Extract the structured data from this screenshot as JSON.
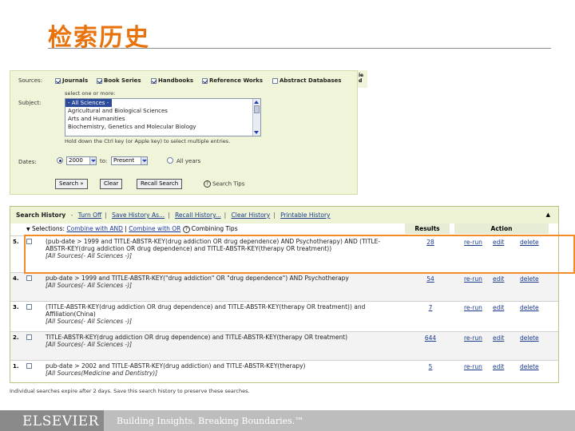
{
  "slide": {
    "title": "检索历史"
  },
  "search_form": {
    "panel_cut_text": "ie d",
    "sources_label": "Sources:",
    "sources": [
      {
        "label": "Journals",
        "checked": true
      },
      {
        "label": "Book Series",
        "checked": true
      },
      {
        "label": "Handbooks",
        "checked": true
      },
      {
        "label": "Reference Works",
        "checked": true
      },
      {
        "label": "Abstract Databases",
        "checked": false
      }
    ],
    "subject_label": "Subject:",
    "subject_hint": "select one or more:",
    "subject_options": [
      "- All Sciences -",
      "Agricultural and Biological Sciences",
      "Arts and Humanities",
      "Biochemistry, Genetics and Molecular Biology"
    ],
    "subject_help": "Hold down the Ctrl key (or Apple key) to select multiple entries.",
    "dates_label": "Dates:",
    "date_from": "2000",
    "date_to_label": "to:",
    "date_to": "Present",
    "all_years_label": "All years",
    "buttons": {
      "search": "Search »",
      "clear": "Clear",
      "recall": "Recall Search"
    },
    "search_tips": "Search Tips"
  },
  "history": {
    "title": "Search History",
    "links": [
      "Turn Off",
      "Save History As...",
      "Recall History...",
      "Clear History",
      "Printable History"
    ],
    "select_label": "Selections:",
    "combine_and": "Combine with AND",
    "combine_or": "Combine with OR",
    "combining_tips": "Combining Tips",
    "columns": {
      "results": "Results",
      "action": "Action"
    },
    "action_labels": {
      "rerun": "re-run",
      "edit": "edit",
      "delete": "delete"
    },
    "rows": [
      {
        "num": "5.",
        "query": "(pub-date > 1999 and TITLE-ABSTR-KEY(drug addiction OR drug dependence) AND Psychotherapy) AND (TITLE-ABSTR-KEY(drug addiction OR drug dependence) and TITLE-ABSTR-KEY(therapy OR treatment))",
        "sources": "[All Sources(- All Sciences -)]",
        "results": "28"
      },
      {
        "num": "4.",
        "query": "pub-date > 1999 and TITLE-ABSTR-KEY(\"drug addiction\" OR \"drug dependence\") AND Psychotherapy",
        "sources": "[All Sources(- All Sciences -)]",
        "results": "54"
      },
      {
        "num": "3.",
        "query": "(TITLE-ABSTR-KEY(drug addiction OR drug dependence) and TITLE-ABSTR-KEY(therapy OR treatment)) and Affiliation(China)",
        "sources": "[All Sources(- All Sciences -)]",
        "results": "7"
      },
      {
        "num": "2.",
        "query": "TITLE-ABSTR-KEY(drug addiction OR drug dependence) and TITLE-ABSTR-KEY(therapy OR treatment)",
        "sources": "[All Sources(- All Sciences -)]",
        "results": "644"
      },
      {
        "num": "1.",
        "query": "pub-date > 2002 and TITLE-ABSTR-KEY(drug addiction) and TITLE-ABSTR-KEY(therapy)",
        "sources": "[All Sources(Medicine and Dentistry)]",
        "results": "5"
      }
    ],
    "footnote": "Individual searches expire after 2 days. Save this search history to preserve these searches."
  },
  "footer": {
    "logo": "ELSEVIER",
    "tagline": "Building Insights. Breaking Boundaries.™"
  },
  "colors": {
    "title": "#e8720c",
    "highlight": "#f28c28",
    "panel_bg": "#f0f5d9",
    "link": "#1a3a8e"
  }
}
